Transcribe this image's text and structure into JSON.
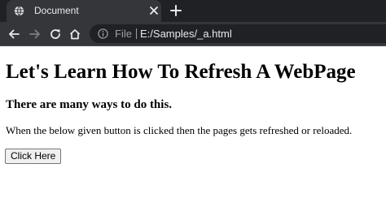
{
  "browser": {
    "tab": {
      "title": "Document",
      "favicon": "globe-icon"
    },
    "toolbar": {
      "origin_label": "File",
      "url": "E:/Samples/_a.html"
    },
    "colors": {
      "tabstrip": "#202124",
      "toolbar": "#35363a",
      "omnibox": "#202124"
    }
  },
  "page": {
    "heading": "Let's Learn How To Refresh A WebPage",
    "subheading": "There are many ways to do this.",
    "paragraph": "When the below given button is clicked then the pages gets refreshed or reloaded.",
    "button_label": "Click Here"
  }
}
